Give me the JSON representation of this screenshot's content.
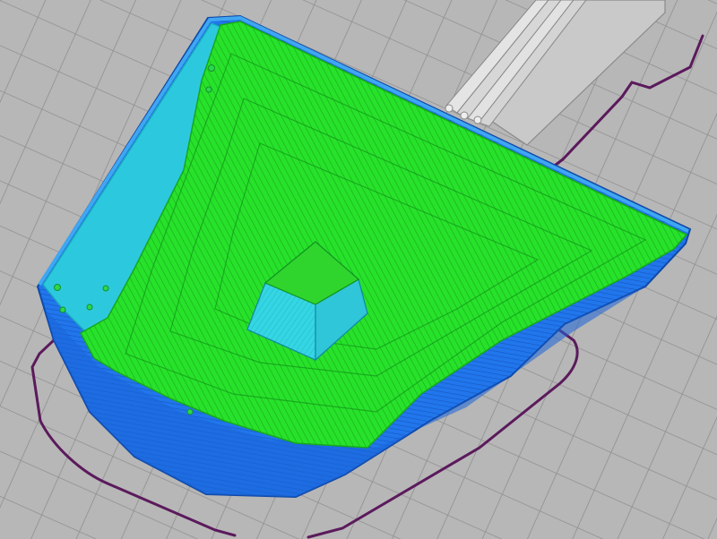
{
  "viewport": {
    "bed_color": "#b7b7b7",
    "grid_color": "#8f8f8f",
    "skirt_color": "#5b1a5c"
  },
  "model": {
    "top_infill_color": "#22e11f",
    "inner_wall_color": "#22c9df",
    "outer_wall_color": "#1f6fe8",
    "support_block_color": "#34d7e4"
  },
  "neighbor_object": {
    "color": "#c8c8c8"
  }
}
